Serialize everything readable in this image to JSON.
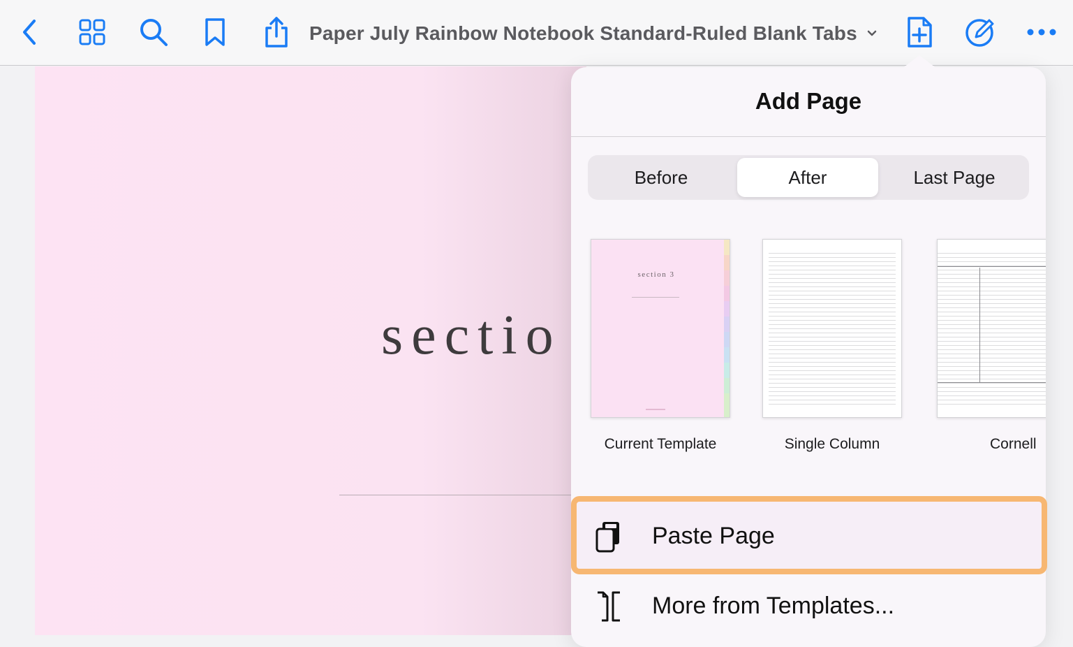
{
  "toolbar": {
    "document_title": "Paper July Rainbow Notebook Standard-Ruled Blank Tabs",
    "accent_color": "#1a7cf5",
    "icons": [
      "back-chevron-icon",
      "grid-icon",
      "search-icon",
      "bookmark-icon",
      "share-icon",
      "title-chevron-down-icon",
      "add-page-icon",
      "annotate-icon",
      "more-icon"
    ]
  },
  "page": {
    "heading": "sectio"
  },
  "add_page_popover": {
    "title": "Add Page",
    "position_options": [
      "Before",
      "After",
      "Last Page"
    ],
    "selected_position": "After",
    "templates": [
      {
        "label": "Current Template",
        "thumb_text": "section 3"
      },
      {
        "label": "Single Column"
      },
      {
        "label": "Cornell"
      }
    ],
    "actions": [
      {
        "label": "Paste Page",
        "icon": "paste-icon",
        "highlighted": true
      },
      {
        "label": "More from Templates...",
        "icon": "templates-icon"
      }
    ],
    "highlight_color": "#f7b772"
  }
}
